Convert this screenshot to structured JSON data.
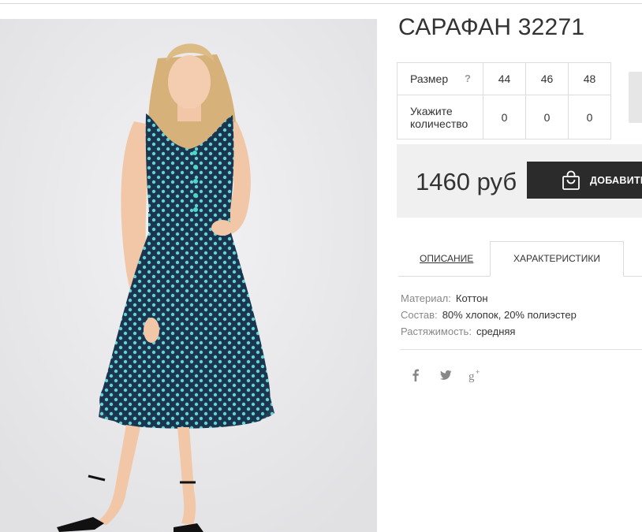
{
  "product": {
    "title": "САРАФАН 32271",
    "image_alt": "Сарафан в горошек"
  },
  "sizes": {
    "size_label": "Размер",
    "help": "?",
    "values": [
      "44",
      "46",
      "48"
    ],
    "qty_label": "Укажите количество",
    "quantities": [
      "0",
      "0",
      "0"
    ]
  },
  "purchase": {
    "price": "1460 руб",
    "add_label": "ДОБАВИТЬ"
  },
  "tabs": {
    "description": "ОПИСАНИЕ",
    "characteristics": "ХАРАКТЕРИСТИКИ"
  },
  "characteristics": [
    {
      "key": "Материал:",
      "value": "Коттон"
    },
    {
      "key": "Состав:",
      "value": "80% хлопок, 20% полиэстер"
    },
    {
      "key": "Растяжимость:",
      "value": "средняя"
    }
  ],
  "social": [
    "facebook-icon",
    "twitter-icon",
    "google-plus-icon"
  ],
  "colors": {
    "button_bg": "#2b2b2b",
    "price_bg": "#f0f0f0",
    "dress": "#1b3550",
    "dots": "#5fd4d0"
  }
}
